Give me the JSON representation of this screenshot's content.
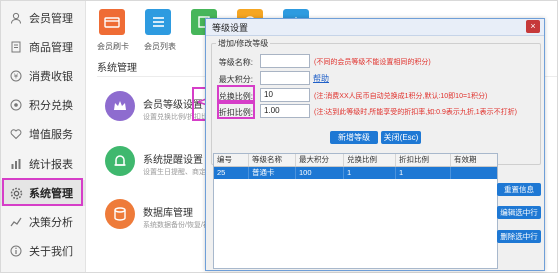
{
  "sidebar": {
    "items": [
      {
        "label": "会员管理",
        "icon": "user-icon"
      },
      {
        "label": "商品管理",
        "icon": "document-icon"
      },
      {
        "label": "消费收银",
        "icon": "yen-icon"
      },
      {
        "label": "积分兑换",
        "icon": "points-icon"
      },
      {
        "label": "增值服务",
        "icon": "heart-icon"
      },
      {
        "label": "统计报表",
        "icon": "bar-chart-icon"
      },
      {
        "label": "系统管理",
        "icon": "gear-icon"
      },
      {
        "label": "决策分析",
        "icon": "trend-icon"
      },
      {
        "label": "关于我们",
        "icon": "info-icon"
      }
    ],
    "active_index": 6
  },
  "main": {
    "top_tiles": [
      {
        "label": "会员刷卡",
        "color": "#ef6c35"
      },
      {
        "label": "会员列表",
        "color": "#2e9be0"
      },
      {
        "label": "",
        "color": "#47b65a"
      },
      {
        "label": "",
        "color": "#f5a623"
      },
      {
        "label": "",
        "color": "#2e9be0"
      }
    ],
    "section_title": "系统管理",
    "cards": [
      {
        "title": "会员等级设置",
        "subtitle": "设置兑换比例/折扣比",
        "icon": "crown-icon",
        "color": "#8e6ccf"
      },
      {
        "title": "系统提醒设置",
        "subtitle": "设置生日提醒、商定义提醒",
        "icon": "bell-icon",
        "color": "#3fb86e"
      },
      {
        "title": "数据库管理",
        "subtitle": "系统数据备份/恢复/初始",
        "icon": "database-icon",
        "color": "#ee7b3a"
      }
    ]
  },
  "dialog": {
    "title": "等级设置",
    "close": "×",
    "group_title": "增加/修改等级",
    "fields": {
      "level_name": {
        "label": "等级名称:",
        "value": "",
        "note": "(不同的会员等级不能设置相同的积分)"
      },
      "max_points": {
        "label": "最大积分:",
        "value": "",
        "link": "帮助"
      },
      "exchange_ratio": {
        "label": "兑换比例:",
        "value": "10",
        "note": "(注:消费XX人民币自动兑换成1积分,默认:10即10=1积分)"
      },
      "discount_ratio": {
        "label": "折扣比例:",
        "value": "1.00",
        "note": "(注:达到此等级时,所能享受的折扣率,如:0.9表示九折,1表示不打折)"
      }
    },
    "buttons": {
      "add": "新增等级",
      "close": "关闭(Esc)"
    },
    "table": {
      "columns": [
        "编号",
        "等级名称",
        "最大积分",
        "兑换比例",
        "折扣比例",
        "有效期"
      ],
      "rows": [
        [
          "25",
          "普通卡",
          "100",
          "1",
          "1",
          ""
        ]
      ]
    },
    "side_buttons": [
      "重置信息",
      "编辑选中行",
      "删除选中行"
    ]
  },
  "colors": {
    "accent": "#1e78d4",
    "highlight": "#d63ec8",
    "note": "#e0302b"
  }
}
